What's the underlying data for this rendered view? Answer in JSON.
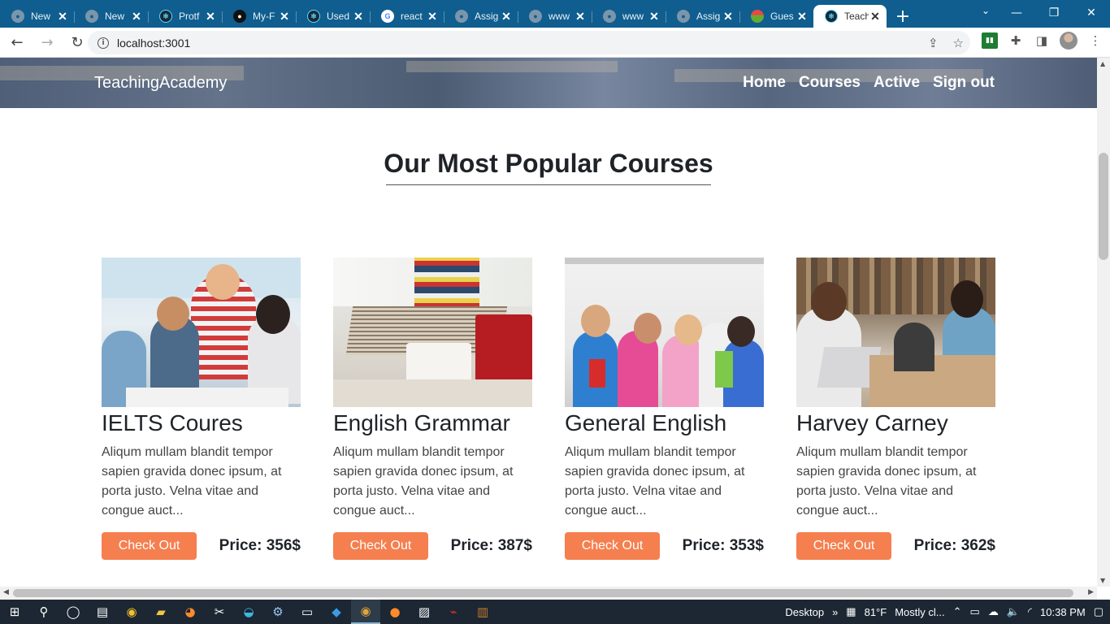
{
  "browser": {
    "tabs": [
      {
        "title": "New",
        "icon": "globe"
      },
      {
        "title": "New",
        "icon": "globe"
      },
      {
        "title": "Protf",
        "icon": "react"
      },
      {
        "title": "My-F",
        "icon": "github"
      },
      {
        "title": "Used",
        "icon": "react"
      },
      {
        "title": "react",
        "icon": "google"
      },
      {
        "title": "Assig",
        "icon": "globe"
      },
      {
        "title": "www",
        "icon": "globe"
      },
      {
        "title": "www",
        "icon": "globe"
      },
      {
        "title": "Assig",
        "icon": "globe"
      },
      {
        "title": "Gues",
        "icon": "image"
      },
      {
        "title": "Teach",
        "icon": "react",
        "active": true
      }
    ],
    "url": "localhost:3001"
  },
  "site": {
    "brand": "TeachingAcademy",
    "nav": [
      "Home",
      "Courses",
      "Active",
      "Sign out"
    ]
  },
  "section": {
    "title": "Our Most Popular Courses"
  },
  "courses": [
    {
      "name": "IELTS Coures",
      "description": "Aliqum mullam blandit tempor sapien gravida donec ipsum, at porta justo. Velna vitae and congue auct...",
      "button": "Check Out",
      "price": "Price: 356$"
    },
    {
      "name": "English Grammar",
      "description": "Aliqum mullam blandit tempor sapien gravida donec ipsum, at porta justo. Velna vitae and congue auct...",
      "button": "Check Out",
      "price": "Price: 387$"
    },
    {
      "name": "General English",
      "description": "Aliqum mullam blandit tempor sapien gravida donec ipsum, at porta justo. Velna vitae and congue auct...",
      "button": "Check Out",
      "price": "Price: 353$"
    },
    {
      "name": "Harvey Carney",
      "description": "Aliqum mullam blandit tempor sapien gravida donec ipsum, at porta justo. Velna vitae and congue auct...",
      "button": "Check Out",
      "price": "Price: 362$"
    }
  ],
  "taskbar": {
    "desktop_label": "Desktop",
    "temperature": "81°F",
    "weather": "Mostly cl...",
    "time": "10:38 PM"
  },
  "colors": {
    "accent_button": "#f57f4f",
    "tabstrip": "#0f5e8f",
    "taskbar": "#1c2733"
  }
}
